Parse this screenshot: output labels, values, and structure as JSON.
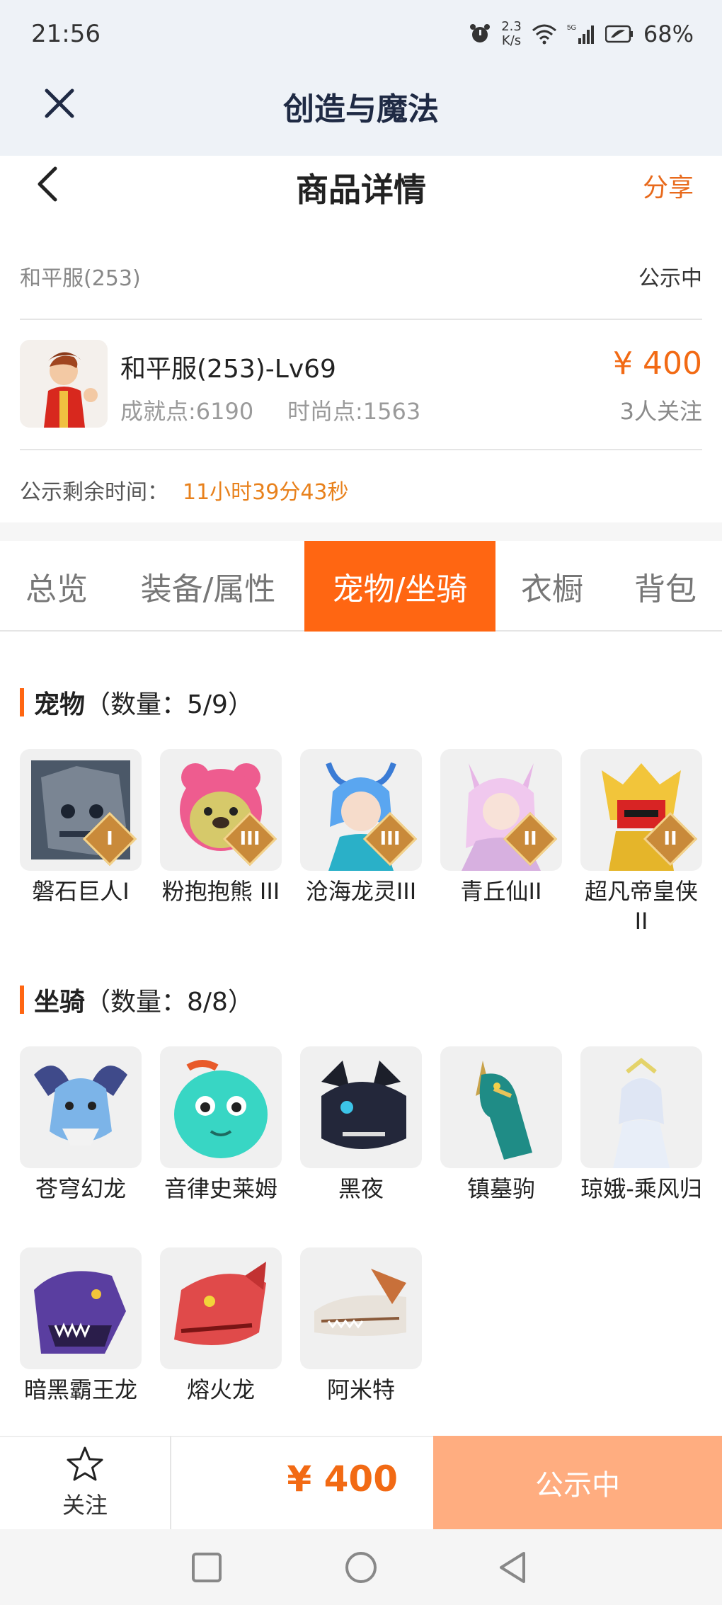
{
  "status_bar": {
    "time": "21:56",
    "speed_value": "2.3",
    "speed_unit": "K/s",
    "network": "5G",
    "battery": "68%"
  },
  "app_bar": {
    "title": "创造与魔法"
  },
  "page_header": {
    "title": "商品详情",
    "share": "分享"
  },
  "listing": {
    "server": "和平服(253)",
    "status": "公示中",
    "name": "和平服(253)-Lv69",
    "achievement": "成就点:6190",
    "fashion": "时尚点:1563",
    "price": "¥ 400",
    "followers": "3人关注",
    "remain_label": "公示剩余时间：",
    "remain_value": "11小时39分43秒"
  },
  "tabs": [
    {
      "label": "总览"
    },
    {
      "label": "装备/属性"
    },
    {
      "label": "宠物/坐骑"
    },
    {
      "label": "衣橱"
    },
    {
      "label": "背包"
    }
  ],
  "pets": {
    "title": "宠物",
    "count": "（数量：5/9）",
    "items": [
      {
        "name": "磐石巨人Ⅰ",
        "badge": "I",
        "icon": "stone-golem"
      },
      {
        "name": "粉抱抱熊 III",
        "badge": "III",
        "icon": "pink-bear"
      },
      {
        "name": "沧海龙灵III",
        "badge": "III",
        "icon": "sea-dragon-spirit"
      },
      {
        "name": "青丘仙II",
        "badge": "II",
        "icon": "fox-fairy"
      },
      {
        "name": "超凡帝皇侠II",
        "badge": "II",
        "icon": "golden-knight"
      }
    ]
  },
  "mounts": {
    "title": "坐骑",
    "count": "（数量：8/8）",
    "items": [
      {
        "name": "苍穹幻龙",
        "icon": "sky-dragon"
      },
      {
        "name": "音律史莱姆",
        "icon": "green-slime"
      },
      {
        "name": "黑夜",
        "icon": "night-fury"
      },
      {
        "name": "镇墓驹",
        "icon": "teal-horse"
      },
      {
        "name": "琼娥-乘风归",
        "icon": "white-fairy"
      },
      {
        "name": "暗黑霸王龙",
        "icon": "purple-trex"
      },
      {
        "name": "熔火龙",
        "icon": "red-dragon"
      },
      {
        "name": "阿米特",
        "icon": "white-croc"
      }
    ]
  },
  "bottom_bar": {
    "follow": "关注",
    "price": "¥ 400",
    "action": "公示中"
  },
  "colors": {
    "accent": "#ff6612",
    "price": "#f26a14",
    "buy_button": "#ffad80"
  }
}
